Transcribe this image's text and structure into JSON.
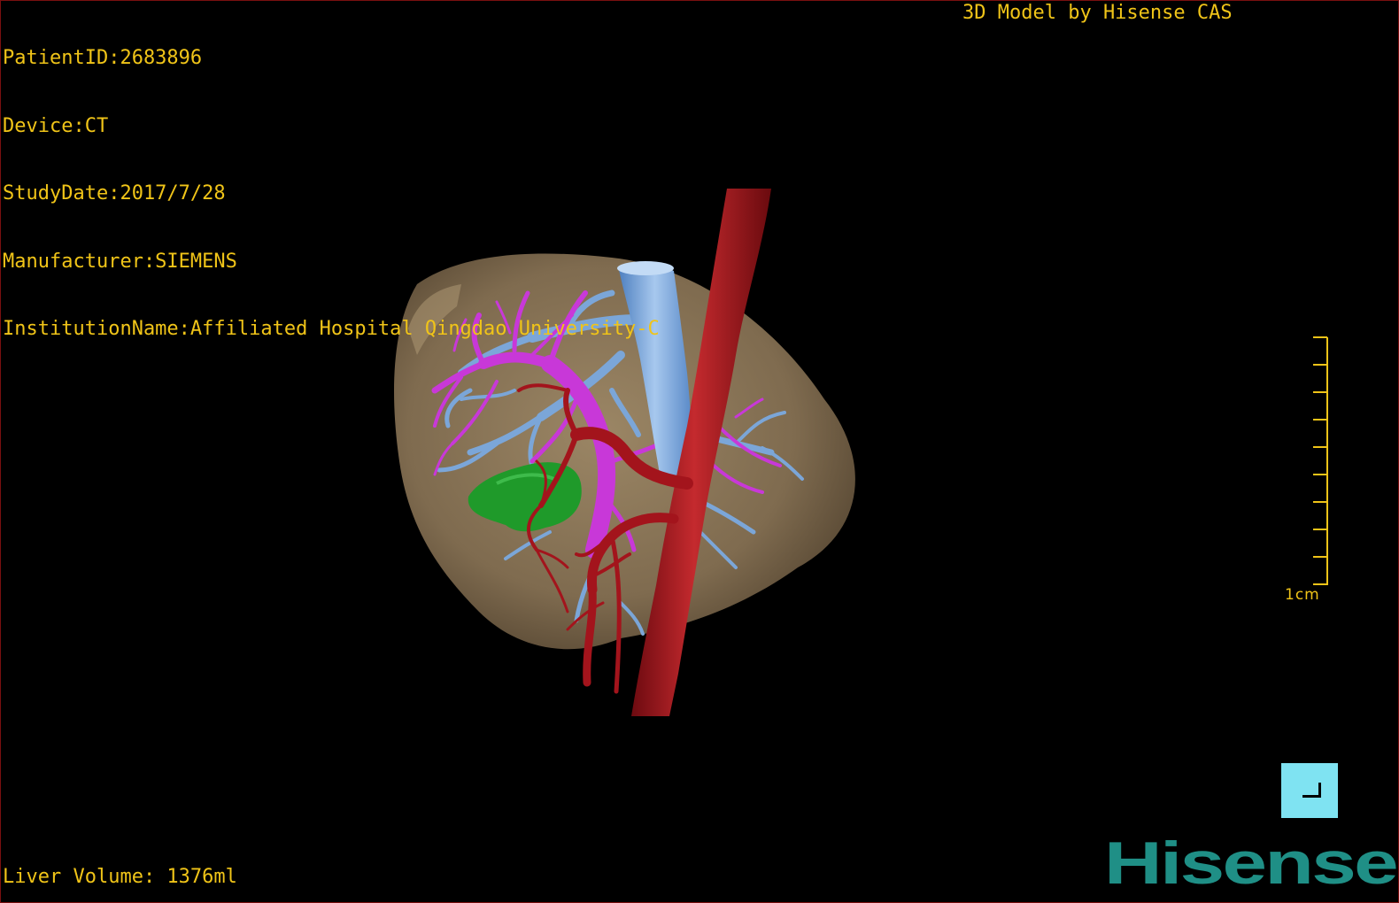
{
  "patient_info": {
    "patient_id": "PatientID:2683896",
    "device": "Device:CT",
    "study_date": "StudyDate:2017/7/28",
    "manufacturer": "Manufacturer:SIEMENS",
    "institution": "InstitutionName:Affiliated Hospital Qingdao University-C"
  },
  "credit": "3D Model by Hisense CAS",
  "liver_volume": "Liver Volume: 1376ml",
  "scale_label": "1cm",
  "logo_text": "Hisense",
  "colors": {
    "overlay_text": "#f0c418",
    "liver": "#8a7558",
    "artery": "#a3141c",
    "vein": "#7ba6d8",
    "portal_vein": "#c838d8",
    "tumor": "#1f9a2a",
    "button": "#7fe3f2",
    "logo": "#1f8f86"
  },
  "icons": {
    "corner_button": "corner-bracket-icon"
  }
}
